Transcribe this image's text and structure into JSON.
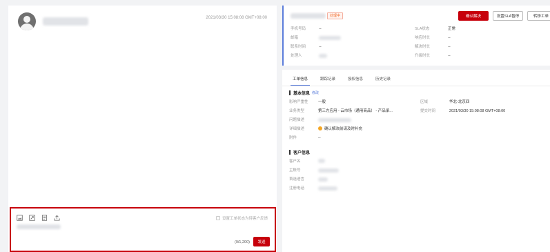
{
  "message": {
    "timestamp": "2021/03/30 15:08:08 GMT+08:00"
  },
  "composer": {
    "toolbar_icons": [
      "image-icon",
      "screenshot-icon",
      "document-icon",
      "upload-icon"
    ],
    "sync_label": "设置工单状态为待客户反馈",
    "counter": "(9/1,200)",
    "send_label": "发送"
  },
  "ticket": {
    "status": "处理中",
    "actions": {
      "confirm": "确认解决",
      "sla_pause": "设置SLA暂停",
      "transfer": "转移工单"
    },
    "info_left": [
      {
        "label": "手机号码",
        "value": "--"
      },
      {
        "label": "邮箱",
        "value": ""
      },
      {
        "label": "联系时间",
        "value": "--"
      },
      {
        "label": "处理人",
        "value": ""
      }
    ],
    "info_right": [
      {
        "label": "SLA状态",
        "value": "正常"
      },
      {
        "label": "响应时长",
        "value": "--"
      },
      {
        "label": "解决时长",
        "value": "--"
      },
      {
        "label": "升级时长",
        "value": "--"
      }
    ]
  },
  "tabs": [
    "工单信息",
    "跟踪记录",
    "授权信息",
    "历史记录"
  ],
  "basic": {
    "title": "基本信息",
    "edit": "修改",
    "rows_left": [
      {
        "label": "影响严重性",
        "value": "一般"
      },
      {
        "label": "业务类型",
        "value": "第三方应用 - 云市场（通用商品） - 产品承..."
      },
      {
        "label": "问题描述",
        "value": ""
      },
      {
        "label": "详细描述",
        "value": "确认解决前请及时补充"
      },
      {
        "label": "附件",
        "value": "--"
      }
    ],
    "rows_right": [
      {
        "label": "区域",
        "value": "华北-北京四"
      },
      {
        "label": "提交时间",
        "value": "2021/03/30 15:08:08 GMT+08:00"
      }
    ]
  },
  "customer": {
    "title": "客户信息",
    "rows": [
      {
        "label": "客户名"
      },
      {
        "label": "主账号"
      },
      {
        "label": "首选语言"
      },
      {
        "label": "注册电话"
      }
    ]
  }
}
